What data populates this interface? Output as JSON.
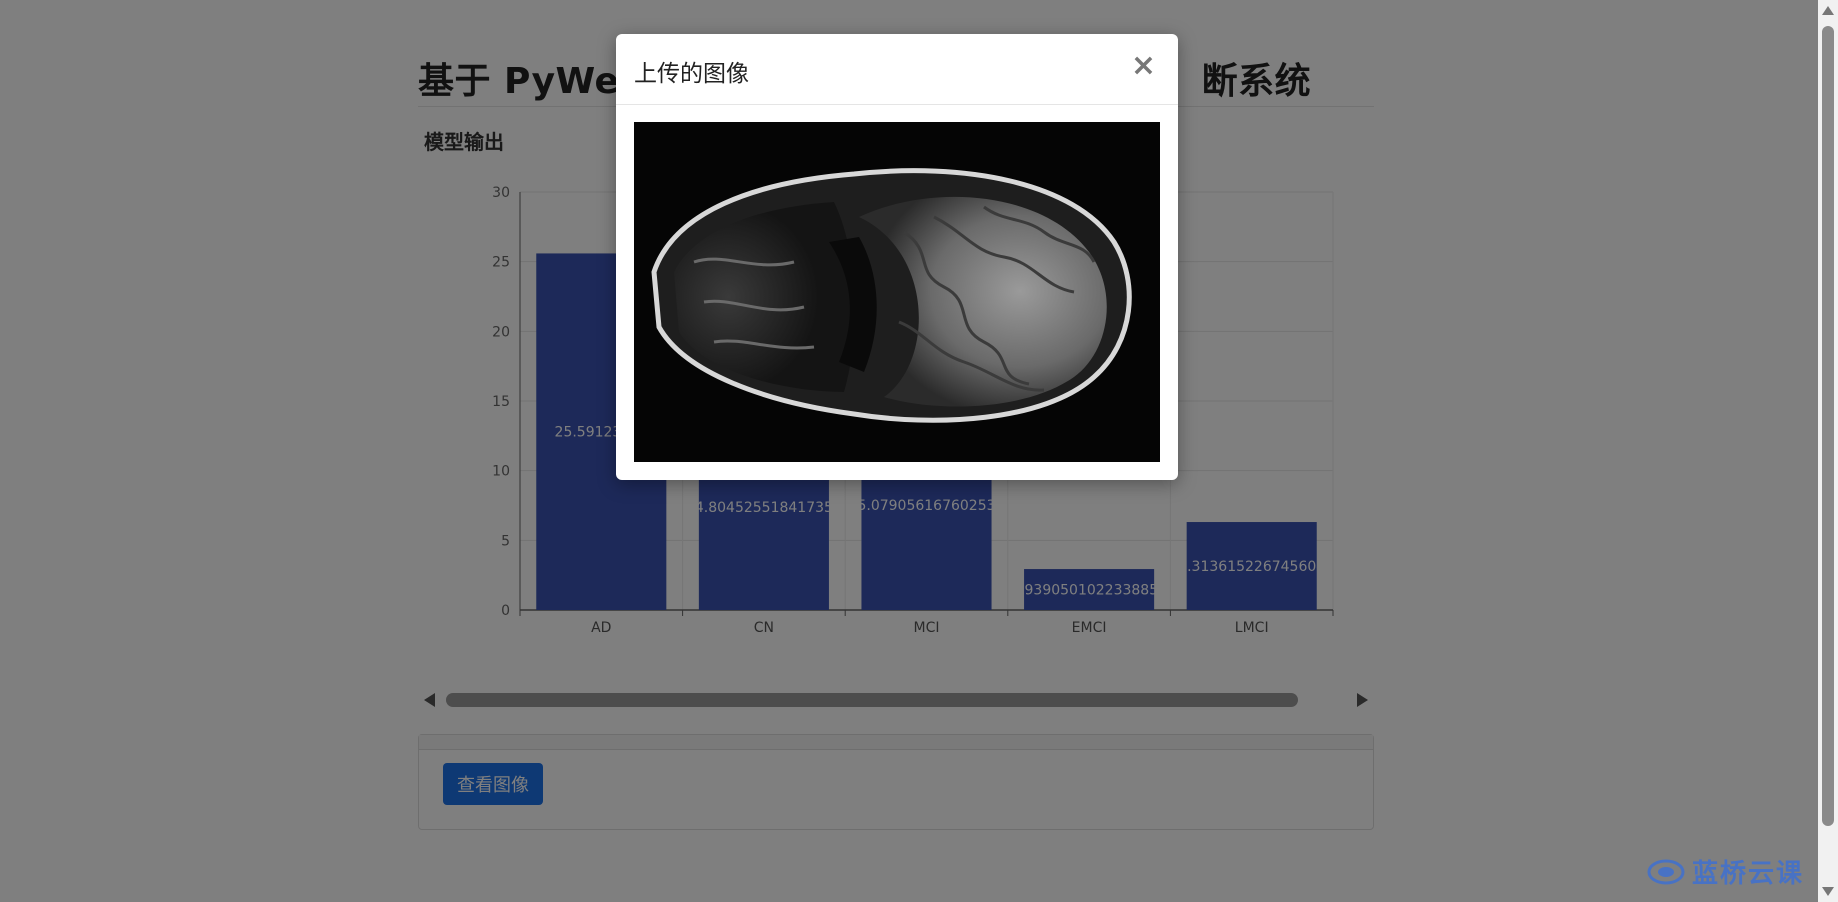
{
  "page": {
    "title": "基于 PyWeb",
    "title_tail": "断系统",
    "section_label": "模型输出",
    "view_button_label": "查看图像"
  },
  "modal": {
    "title": "上传的图像",
    "close_label": "×"
  },
  "watermark": {
    "text": "蓝桥云课"
  },
  "colors": {
    "bar": "#3a53b3",
    "button": "#1d72e8",
    "accent": "#3b6fd6"
  },
  "chart_data": {
    "type": "bar",
    "categories": [
      "AD",
      "CN",
      "MCI",
      "EMCI",
      "LMCI"
    ],
    "values": [
      25.59123649,
      14.804525518417357,
      15.079056167602538,
      2.9390501022338853,
      6.313615226745604
    ],
    "data_labels": [
      "25.59123649",
      "14.804525518417357",
      "15.079056167602538",
      "2.9390501022338853",
      "6.313615226745604"
    ],
    "y_ticks": [
      "0",
      "5",
      "10",
      "15",
      "20",
      "25",
      "30"
    ],
    "ylim": [
      0,
      30
    ],
    "grid": true,
    "title": "",
    "xlabel": "",
    "ylabel": ""
  }
}
